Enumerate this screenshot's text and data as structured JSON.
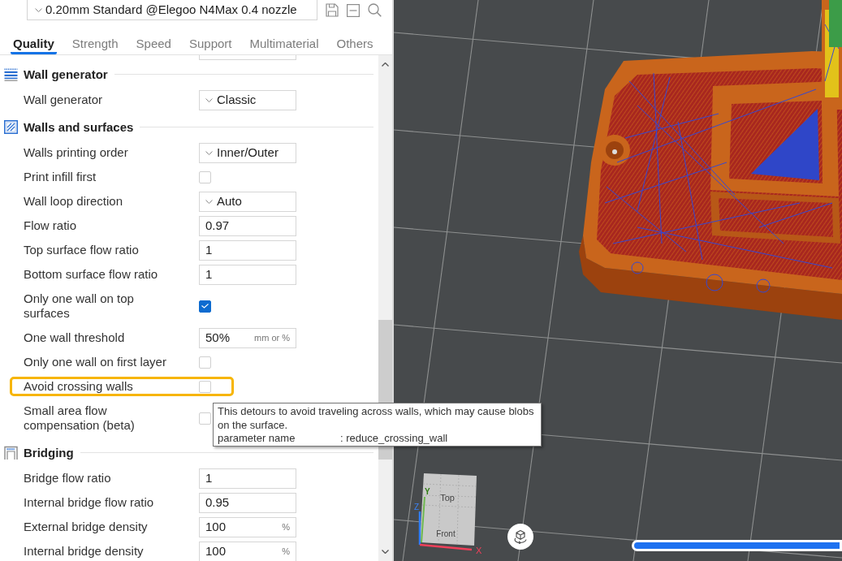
{
  "preset": {
    "value": "0.20mm Standard @Elegoo N4Max 0.4 nozzle"
  },
  "tabs": [
    {
      "label": "Quality",
      "selected": true
    },
    {
      "label": "Strength",
      "selected": false
    },
    {
      "label": "Speed",
      "selected": false
    },
    {
      "label": "Support",
      "selected": false
    },
    {
      "label": "Multimaterial",
      "selected": false
    },
    {
      "label": "Others",
      "selected": false
    }
  ],
  "sections": [
    {
      "kind": "wall_generator",
      "title": "Wall generator",
      "rows": [
        {
          "kind": "dropdown",
          "label": "Wall generator",
          "value": "Classic",
          "highlighted": false
        }
      ]
    },
    {
      "kind": "walls",
      "title": "Walls and surfaces",
      "rows": [
        {
          "kind": "dropdown",
          "label": "Walls printing order",
          "value": "Inner/Outer",
          "highlighted": false
        },
        {
          "kind": "checkbox",
          "label": "Print infill first",
          "checked": false,
          "highlighted": false
        },
        {
          "kind": "dropdown",
          "label": "Wall loop direction",
          "value": "Auto",
          "highlighted": false
        },
        {
          "kind": "number",
          "label": "Flow ratio",
          "value": "0.97",
          "highlighted": false
        },
        {
          "kind": "number",
          "label": "Top surface flow ratio",
          "value": "1",
          "highlighted": false
        },
        {
          "kind": "number",
          "label": "Bottom surface flow ratio",
          "value": "1",
          "highlighted": false
        },
        {
          "kind": "checkbox",
          "label": "Only one wall on top surfaces",
          "checked": true,
          "highlighted": false
        },
        {
          "kind": "number",
          "label": "One wall threshold",
          "value": "50%",
          "unit": "mm or %",
          "highlighted": false
        },
        {
          "kind": "checkbox",
          "label": "Only one wall on first layer",
          "checked": false,
          "highlighted": false
        },
        {
          "kind": "checkbox",
          "label": "Avoid crossing walls",
          "checked": false,
          "highlighted": true
        },
        {
          "kind": "checkbox",
          "label": "Small area flow compensation (beta)",
          "checked": false,
          "highlighted": false
        }
      ]
    },
    {
      "kind": "bridging",
      "title": "Bridging",
      "rows": [
        {
          "kind": "number",
          "label": "Bridge flow ratio",
          "value": "1",
          "highlighted": false
        },
        {
          "kind": "number",
          "label": "Internal bridge flow ratio",
          "value": "0.95",
          "highlighted": false
        },
        {
          "kind": "number",
          "label": "External bridge density",
          "value": "100",
          "unit": "%",
          "highlighted": false
        },
        {
          "kind": "number",
          "label": "Internal bridge density",
          "value": "100",
          "unit": "%",
          "highlighted": false
        }
      ]
    }
  ],
  "tooltip": {
    "text": "This detours to avoid traveling across walls, which may cause blobs on the surface.",
    "parameter_label": "parameter name",
    "parameter_value": ": reduce_crossing_wall"
  },
  "viewport": {
    "view_cube": {
      "top_label": "Top",
      "front_label": "Front",
      "x_label": "X",
      "y_label": "Y",
      "z_label": "Z"
    },
    "slider": {
      "level": 1
    }
  }
}
